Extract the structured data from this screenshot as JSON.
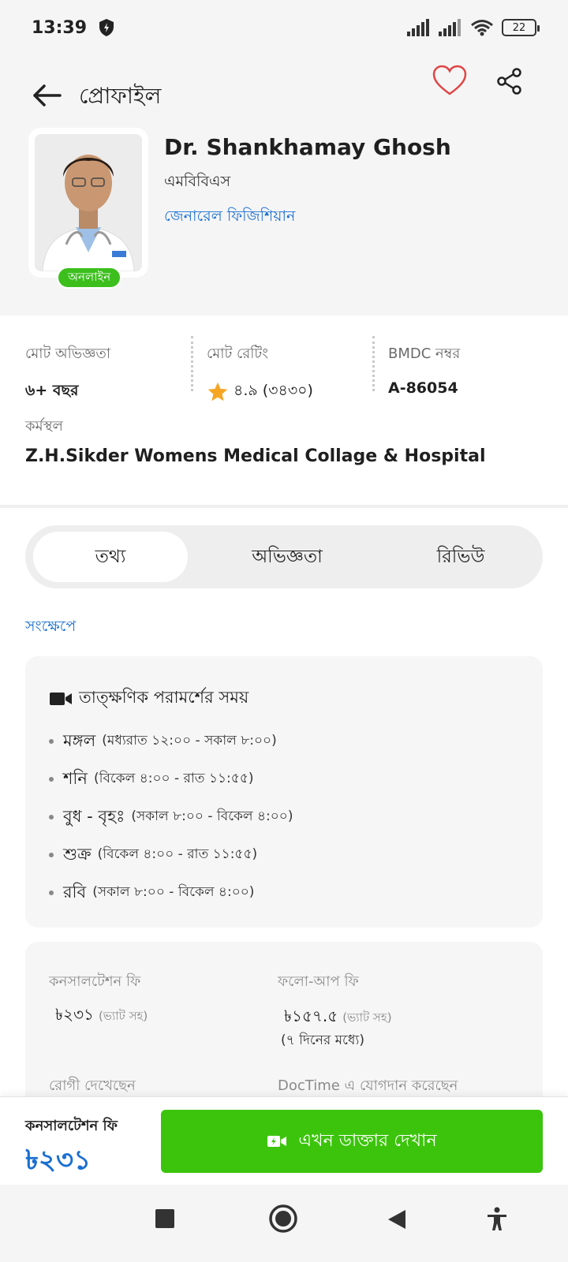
{
  "status_bar": {
    "time": "13:39",
    "battery": "22"
  },
  "header": {
    "title": "প্রোফাইল",
    "icons": {
      "back": "arrow-left-icon",
      "favorite": "heart-outline-icon",
      "share": "share-icon"
    },
    "colors": {
      "favorite": "#e04545"
    }
  },
  "doctor": {
    "name": "Dr. Shankhamay Ghosh",
    "degree": "এমবিবিএস",
    "specialty": "জেনারেল ফিজিশিয়ান",
    "status_badge": "অনলাইন"
  },
  "stats": {
    "experience": {
      "label": "মোট অভিজ্ঞতা",
      "value": "৬+ বছর"
    },
    "rating": {
      "label": "মোট রেটিং",
      "value": "৪.৯ (৩৪৩০)"
    },
    "bmdc": {
      "label": "BMDC নম্বর",
      "value": "A-86054"
    }
  },
  "workplace": {
    "label": "কর্মস্থল",
    "value": "Z.H.Sikder Womens Medical Collage & Hospital"
  },
  "tabs": [
    {
      "label": "তথ্য",
      "active": true
    },
    {
      "label": "অভিজ্ঞতা",
      "active": false
    },
    {
      "label": "রিভিউ",
      "active": false
    }
  ],
  "summary": {
    "title": "সংক্ষেপে",
    "schedule_title": "তাত্ক্ষণিক পরামর্শের সময়",
    "schedule": [
      {
        "day": "মঙ্গল",
        "time": "(মধ্যরাত ১২:০০ - সকাল ৮:০০)"
      },
      {
        "day": "শনি",
        "time": "(বিকেল ৪:০০ - রাত ১১:৫৫)"
      },
      {
        "day": "বুধ - বৃহঃ",
        "time": "(সকাল ৮:০০ - বিকেল ৪:০০)"
      },
      {
        "day": "শুক্র",
        "time": "(বিকেল ৪:০০ - রাত ১১:৫৫)"
      },
      {
        "day": "রবি",
        "time": "(সকাল ৮:০০ - বিকেল ৪:০০)"
      }
    ]
  },
  "fees": {
    "consultation_label": "কনসালটেশন ফি",
    "consultation_value": "৳২৩১",
    "consultation_vat": "(ভ্যাট সহ)",
    "followup_label": "ফলো-আপ ফি",
    "followup_value": "৳১৫৭.৫",
    "followup_vat": "(ভ্যাট সহ)",
    "followup_note": "(৭ দিনের মধ্যে)",
    "patients_label": "রোগী দেখেছেন",
    "joined_label": "DocTime এ যোগদান করেছেন"
  },
  "cta": {
    "fee_label": "কনসালটেশন ফি",
    "fee_value": "৳২৩১",
    "button_label": "এখন ডাক্তার দেখান",
    "color": "#3cc40c"
  },
  "nav_bar": {
    "icons": [
      "square-recents-icon",
      "circle-home-icon",
      "triangle-back-icon",
      "accessibility-icon"
    ]
  }
}
